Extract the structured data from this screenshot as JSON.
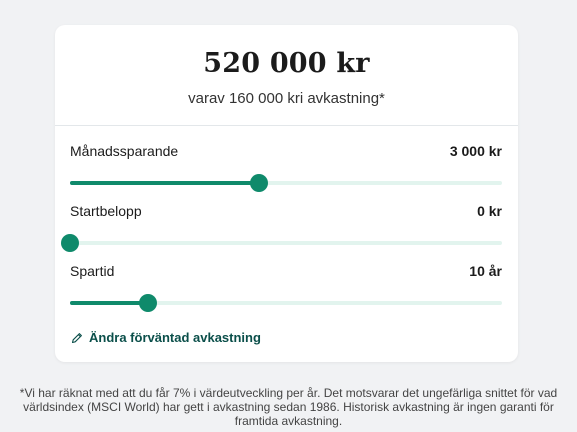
{
  "summary": {
    "total": "520 000 kr",
    "subtitle": "varav 160 000 kri avkastning*"
  },
  "sliders": [
    {
      "label": "Månadssparande",
      "value": "3 000 kr",
      "fraction": 0.438
    },
    {
      "label": "Startbelopp",
      "value": "0 kr",
      "fraction": 0.0
    },
    {
      "label": "Spartid",
      "value": "10 år",
      "fraction": 0.18
    }
  ],
  "edit_link": {
    "label": "Ändra förväntad avkastning",
    "icon": "pencil-icon"
  },
  "footnote": "*Vi har räknat med att du får 7% i värdeutveckling per år. Det motsvarar det ungefärliga snittet för vad världsindex (MSCI World) har gett i avkastning sedan 1986. Historisk avkastning är ingen garanti för framtida avkastning.",
  "colors": {
    "accent": "#0f8a6b",
    "track": "#e2f4ee",
    "link": "#0b4f4a",
    "background": "#f1f2f4",
    "card": "#ffffff"
  }
}
